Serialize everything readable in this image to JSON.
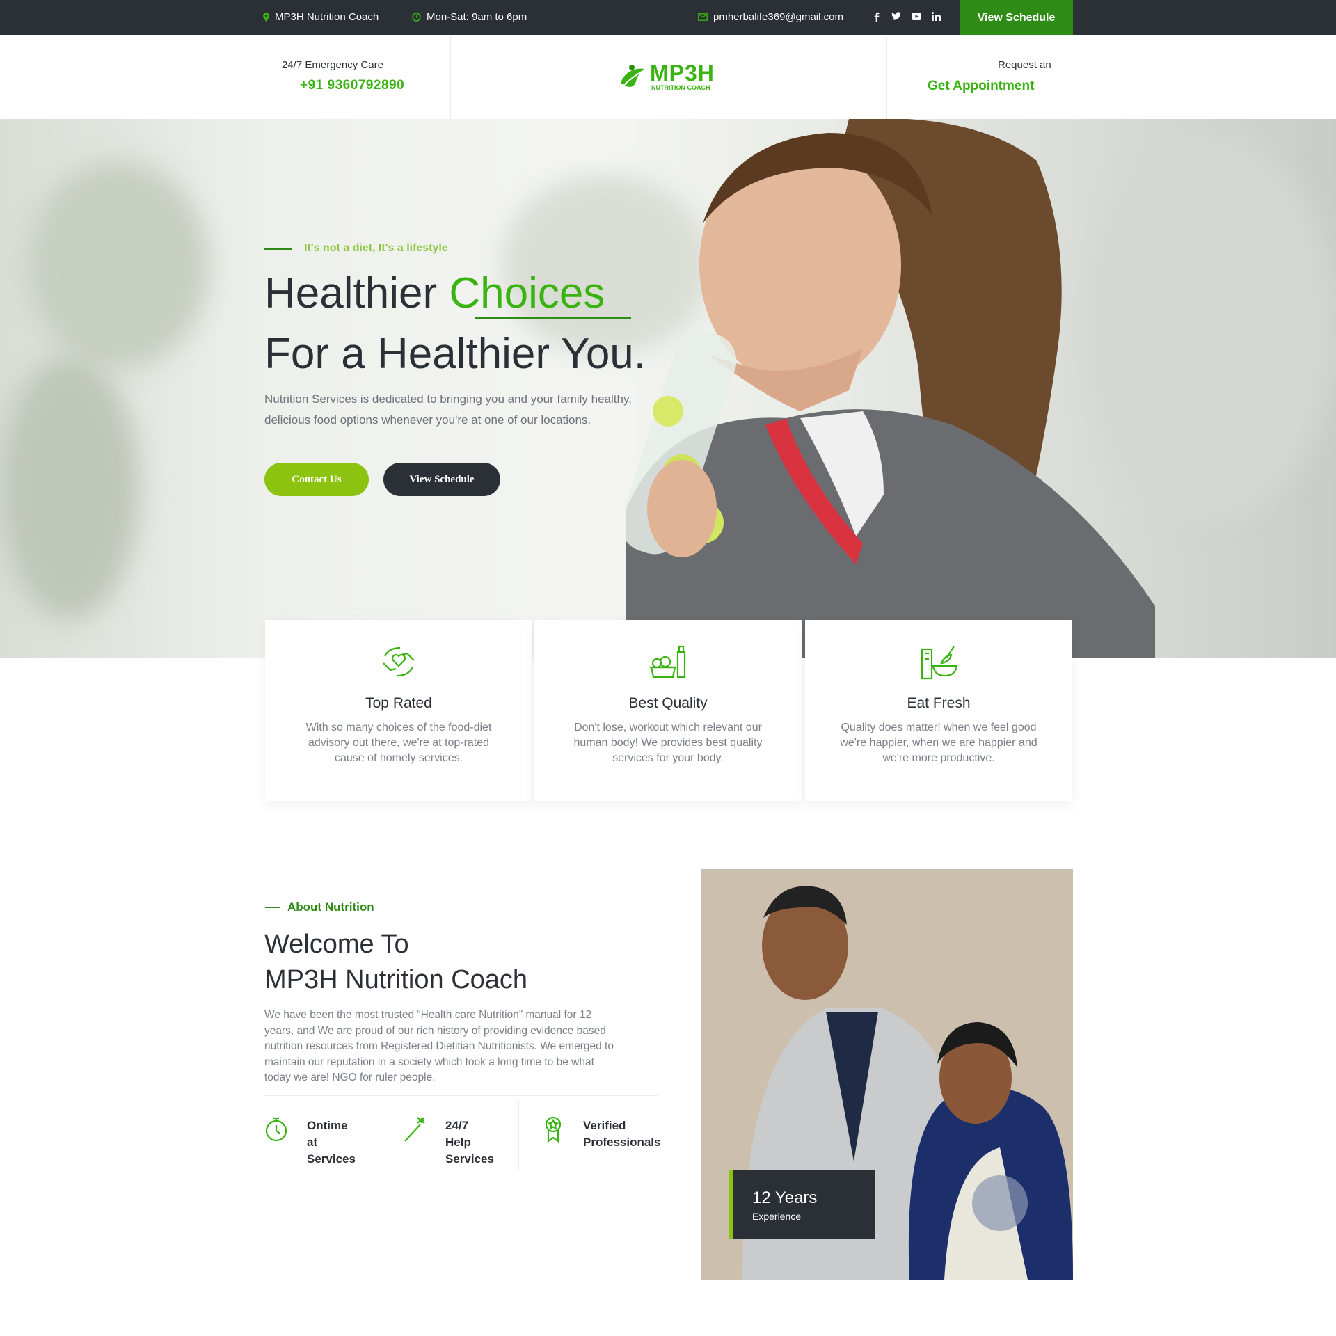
{
  "topbar": {
    "location": "MP3H Nutrition Coach",
    "hours": "Mon-Sat: 9am to 6pm",
    "email": "pmherbalife369@gmail.com",
    "social": [
      "f",
      "t",
      "yt",
      "in"
    ],
    "cta": "View Schedule"
  },
  "header": {
    "emergency_label": "24/7 Emergency Care",
    "phone": "+91 9360792890",
    "logo_text": "MP3H",
    "logo_sub": "NUTRITION COACH",
    "request_label": "Request an",
    "appointment": "Get Appointment"
  },
  "hero": {
    "tagline": "It's not a diet, It's a lifestyle",
    "title_a": "Healthier ",
    "title_accent": "Choices",
    "title_b": "For a Healthier You.",
    "description": "Nutrition Services is dedicated to bringing you and your family healthy, delicious food options whenever you're at one of our locations.",
    "btn_contact": "Contact Us",
    "btn_schedule": "View Schedule"
  },
  "features": [
    {
      "title": "Top Rated",
      "text": "With so many choices of the food-diet advisory out there, we're at top-rated cause of homely services.",
      "icon": "heart-hands-icon"
    },
    {
      "title": "Best Quality",
      "text": "Don't lose, workout which relevant our human body! We provides best quality services for your body.",
      "icon": "food-basket-icon"
    },
    {
      "title": "Eat Fresh",
      "text": "Quality does matter! when we feel good we're happier, when we are happier and we're more productive.",
      "icon": "fresh-bowl-icon"
    }
  ],
  "about": {
    "label": "About Nutrition",
    "title_1": "Welcome To",
    "title_2": "MP3H Nutrition Coach",
    "text": "We have been the most trusted “Health care Nutrition” manual for 12 years, and We are proud of our rich history of providing evidence based nutrition resources from Registered Dietitian Nutritionists. We emerged to maintain our reputation in a society which took a long time to be what today we are! NGO for ruler people.",
    "stats": [
      {
        "lines": [
          "Ontime",
          "at",
          "Services"
        ],
        "icon": "stopwatch-icon"
      },
      {
        "lines": [
          "24/7",
          "Help",
          "Services"
        ],
        "icon": "magic-wand-icon"
      },
      {
        "lines": [
          "Verified",
          "Professionals"
        ],
        "icon": "award-badge-icon"
      }
    ],
    "exp_years": "12 Years",
    "exp_label": "Experience"
  },
  "colors": {
    "green": "#2e8b16",
    "lime": "#8cc63f",
    "dark": "#2b2f36",
    "bright_green": "#39b310"
  }
}
